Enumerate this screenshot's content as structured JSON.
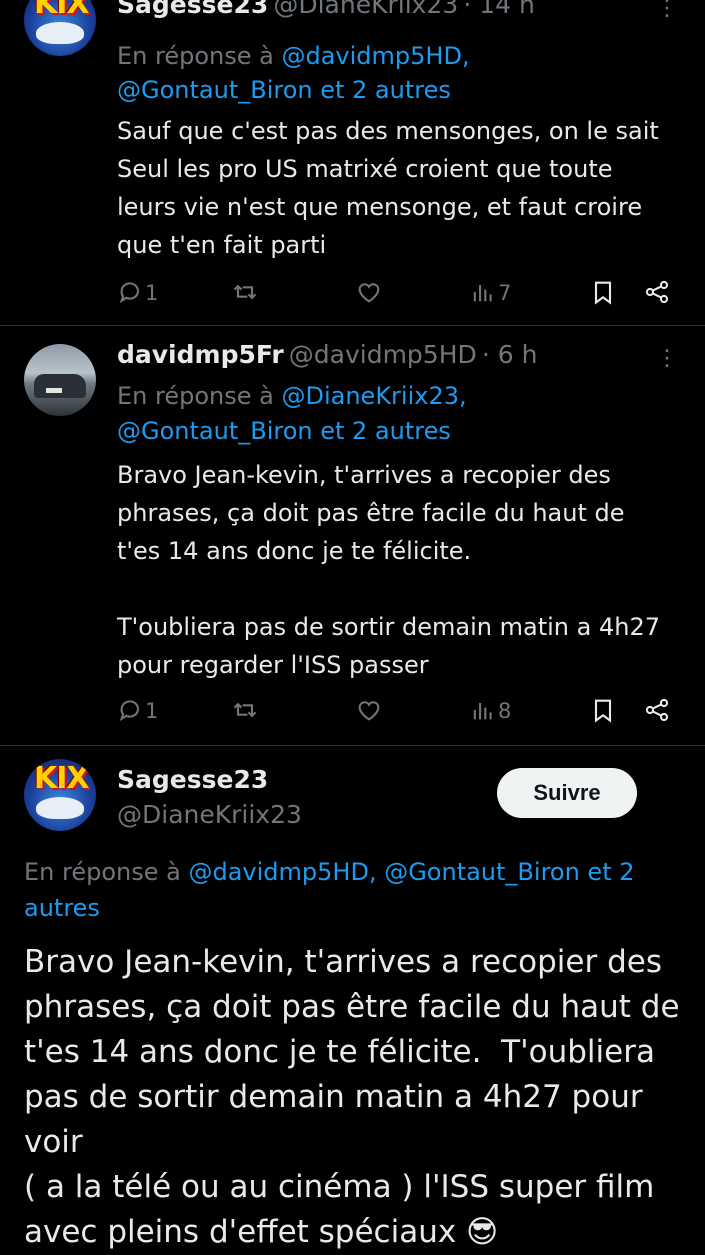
{
  "tweets": [
    {
      "author_name": "Sagesse23",
      "author_handle": "@DianeKriix23",
      "meta": "· 14 h",
      "reply_prefix": "En réponse à",
      "reply_mentions_line1": "@davidmp5HD,",
      "reply_mentions_line2": "@Gontaut_Biron et 2 autres",
      "text": "Sauf que c'est pas des mensonges, on le sait\nSeul les pro US matrixé croient que toute\nleurs vie n'est que mensonge, et faut croire\nque t'en fait parti",
      "reply_count": "1",
      "view_count": "7"
    },
    {
      "author_name": "davidmp5Fr",
      "author_handle": "@davidmp5HD",
      "meta": "· 6 h",
      "reply_prefix": "En réponse à",
      "reply_mentions_line1": "@DianeKriix23,",
      "reply_mentions_line2": "@Gontaut_Biron et 2 autres",
      "text": "Bravo Jean-kevin, t'arrives a recopier des\nphrases, ça doit pas être facile du haut de\nt'es 14 ans donc je te félicite.\n\nT'oubliera pas de sortir demain matin a 4h27\npour regarder l'ISS passer",
      "reply_count": "1",
      "view_count": "8"
    }
  ],
  "main_tweet": {
    "author_name": "Sagesse23",
    "author_handle": "@DianeKriix23",
    "follow_label": "Suivre",
    "reply_prefix": "En réponse à",
    "reply_mentions": "@davidmp5HD, @Gontaut_Biron et 2",
    "reply_mentions_line2": "autres",
    "text": "Bravo Jean-kevin, t'arrives a recopier des\nphrases, ça doit pas être facile du haut de\nt'es 14 ans donc je te félicite.  T'oubliera\npas de sortir demain matin a 4h27 pour voir\n( a la télé ou au cinéma ) l'ISS super film\navec pleins d'effet spéciaux 😎"
  },
  "avatars": {
    "kix_logo_text": "KIX"
  },
  "colors": {
    "background": "#000000",
    "text": "#e7e9ea",
    "secondary": "#71767b",
    "link": "#1d9bf0"
  }
}
